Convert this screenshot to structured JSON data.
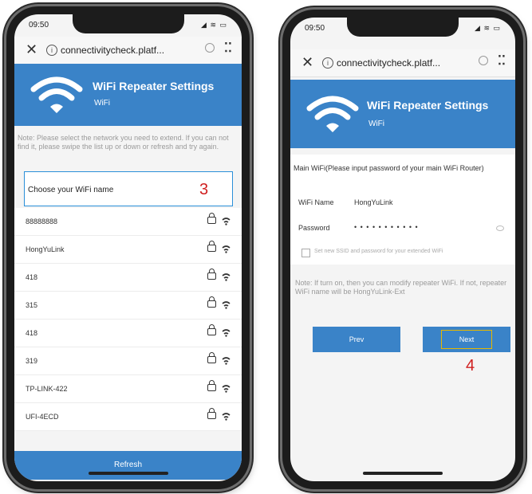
{
  "left_phone": {
    "status_time": "09:50",
    "status_icons": "◢ ≋ ▭",
    "url": "connectivitycheck.platf...",
    "banner_title": "WiFi Repeater Settings",
    "banner_subtitle": "WiFi",
    "note": "Note: Please select the network you need to extend. If you can not find it, please swipe the list up or down or refresh and try again.",
    "choose_label": "Choose your WiFi name",
    "callout": "3",
    "networks": [
      "88888888",
      "HongYuLink",
      "418",
      "315",
      "418",
      "319",
      "TP-LINK-422",
      "UFI-4ECD"
    ],
    "refresh_label": "Refresh"
  },
  "right_phone": {
    "status_time": "09:50",
    "status_icons": "◢ ≋ ▭",
    "url": "connectivitycheck.platf...",
    "banner_title": "WiFi Repeater Settings",
    "banner_subtitle": "WiFi",
    "main_wifi_heading": "Main WiFi(Please input password of your main WiFi Router)",
    "wifi_name_label": "WiFi Name",
    "wifi_name_value": "HongYuLink",
    "password_label": "Password",
    "password_value": "• • • • • • • • • • •",
    "checkbox_label": "Set new SSID and password for your extended WiFi",
    "note": "Note: If turn on, then you can modify repeater WiFi. If not, repeater WiFi name will be HongYuLink-Ext",
    "prev_label": "Prev",
    "next_label": "Next",
    "callout": "4"
  },
  "colors": {
    "accent": "#3a83c8",
    "highlight_blue": "#2a8fd8",
    "highlight_yellow": "#e6b800",
    "callout_red": "#d02020"
  }
}
